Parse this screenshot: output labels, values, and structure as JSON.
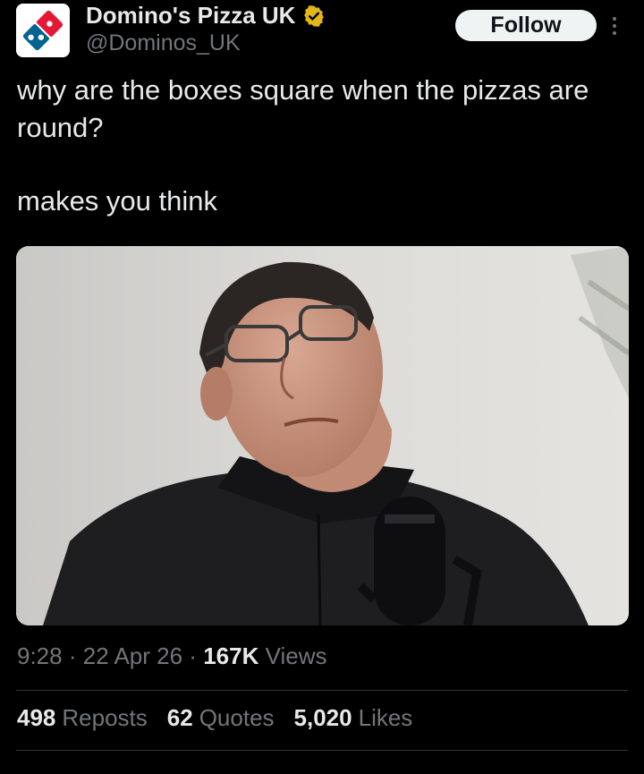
{
  "account": {
    "display_name": "Domino's Pizza UK",
    "handle": "@Dominos_UK",
    "verified_icon": "verified-gold-badge-icon",
    "avatar_icon": "dominos-logo-icon"
  },
  "actions": {
    "follow_label": "Follow",
    "more_icon": "more-vertical-icon"
  },
  "tweet": {
    "line1": "why are the boxes square when the pizzas are round?",
    "line2": "makes you think"
  },
  "media": {
    "kind": "photo"
  },
  "meta": {
    "time": "9:28",
    "date": "22 Apr 26",
    "views_count": "167K",
    "views_label": "Views",
    "separator": "·"
  },
  "stats": {
    "reposts_count": "498",
    "reposts_label": "Reposts",
    "quotes_count": "62",
    "quotes_label": "Quotes",
    "likes_count": "5,020",
    "likes_label": "Likes"
  },
  "colors": {
    "background": "#000000",
    "text_primary": "#e7e9ea",
    "text_secondary": "#71767b",
    "verified_gold": "#e2b719",
    "dominos_blue": "#006491",
    "dominos_red": "#e31837"
  }
}
